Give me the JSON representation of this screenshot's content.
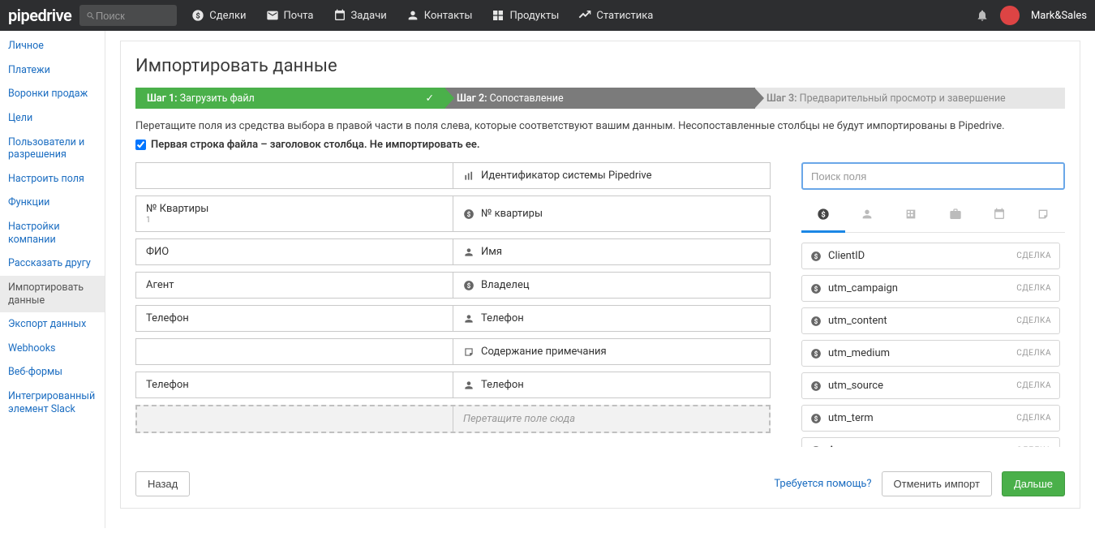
{
  "topbar": {
    "logo": "pipedrive",
    "search_placeholder": "Поиск",
    "nav": [
      "Сделки",
      "Почта",
      "Задачи",
      "Контакты",
      "Продукты",
      "Статистика"
    ],
    "username": "Mark&Sales"
  },
  "sidebar": {
    "items": [
      "Личное",
      "Платежи",
      "Воронки продаж",
      "Цели",
      "Пользователи и разрешения",
      "Настроить поля",
      "Функции",
      "Настройки компании",
      "Рассказать другу",
      "Импортировать данные",
      "Экспорт данных",
      "Webhooks",
      "Веб-формы",
      "Интегрированный элемент Slack"
    ],
    "active_index": 9
  },
  "page": {
    "title": "Импортировать данные",
    "stepper": {
      "s1_label": "Шаг 1:",
      "s1_text": "Загрузить файл",
      "s2_label": "Шаг 2:",
      "s2_text": "Сопоставление",
      "s3_label": "Шаг 3:",
      "s3_text": "Предварительный просмотр и завершение"
    },
    "instruction": "Перетащите поля из средства выбора в правой части в поля слева, которые соответствуют вашим данным. Несопоставленные столбцы не будут импортированы в Pipedrive.",
    "first_row_header_label": "Первая строка файла – заголовок столбца. Не импортировать ее.",
    "first_row_header_checked": true,
    "map_rows": [
      {
        "src": "",
        "sub": "",
        "dst": "Идентификатор системы Pipedrive",
        "icon": "bars"
      },
      {
        "src": "№ Квартиры",
        "sub": "1",
        "dst": "№ квартиры",
        "icon": "dollar"
      },
      {
        "src": "ФИО",
        "sub": "",
        "dst": "Имя",
        "icon": "person"
      },
      {
        "src": "Агент",
        "sub": "",
        "dst": "Владелец",
        "icon": "dollar"
      },
      {
        "src": "Телефон",
        "sub": "",
        "dst": "Телефон",
        "icon": "person"
      },
      {
        "src": "",
        "sub": "",
        "dst": "Содержание примечания",
        "icon": "note"
      },
      {
        "src": "Телефон",
        "sub": "",
        "dst": "Телефон",
        "icon": "person"
      },
      {
        "src": "",
        "sub": "",
        "dst": "Перетащите поле сюда",
        "placeholder": true
      }
    ],
    "field_search_placeholder": "Поиск поля",
    "field_type_label": "СДЕЛКА",
    "fields": [
      {
        "name": "ClientID"
      },
      {
        "name": "utm_campaign"
      },
      {
        "name": "utm_content"
      },
      {
        "name": "utm_medium"
      },
      {
        "name": "utm_source"
      },
      {
        "name": "utm_term"
      },
      {
        "name": "Акционная цена"
      }
    ],
    "footer": {
      "back": "Назад",
      "help": "Требуется помощь?",
      "cancel": "Отменить импорт",
      "next": "Дальше"
    }
  }
}
